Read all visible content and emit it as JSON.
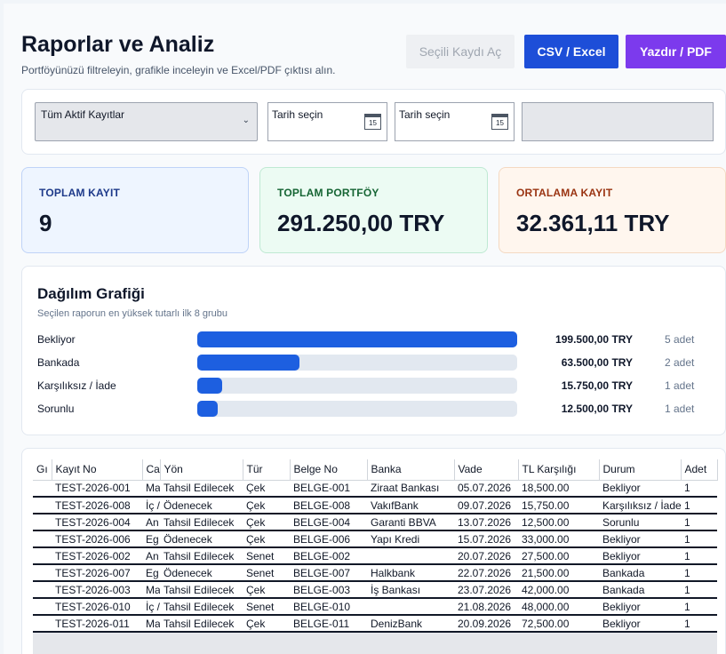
{
  "header": {
    "title": "Raporlar ve Analiz",
    "subtitle": "Portföyünüzü filtreleyin, grafikle inceleyin ve Excel/PDF çıktısı alın.",
    "buttons": {
      "open_selected": "Seçili Kaydı Aç",
      "csv": "CSV / Excel",
      "print": "Yazdır / PDF"
    }
  },
  "filters": {
    "report_select": "Tüm Aktif Kayıtlar",
    "date_start_placeholder": "Tarih seçin",
    "date_end_placeholder": "Tarih seçin",
    "calendar_glyph": "15"
  },
  "stats": [
    {
      "label": "TOPLAM KAYIT",
      "value": "9"
    },
    {
      "label": "TOPLAM PORTFÖY",
      "value": "291.250,00 TRY"
    },
    {
      "label": "ORTALAMA KAYIT",
      "value": "32.361,11 TRY"
    }
  ],
  "chart": {
    "title": "Dağılım Grafiği",
    "subtitle": "Seçilen raporun en yüksek tutarlı ilk 8 grubu"
  },
  "chart_data": {
    "type": "bar",
    "orientation": "horizontal",
    "categories": [
      "Bekliyor",
      "Bankada",
      "Karşılıksız / İade",
      "Sorunlu"
    ],
    "values": [
      199500,
      63500,
      15750,
      12500
    ],
    "amount_labels": [
      "199.500,00 TRY",
      "63.500,00 TRY",
      "15.750,00 TRY",
      "12.500,00 TRY"
    ],
    "counts": [
      "5 adet",
      "2 adet",
      "1 adet",
      "1 adet"
    ],
    "color": "#1d5fe0"
  },
  "table": {
    "columns": [
      "Gı",
      "Kayıt No",
      "Ca",
      "Yön",
      "Tür",
      "Belge No",
      "Banka",
      "Vade",
      "TL Karşılığı",
      "Durum",
      "Adet"
    ],
    "rows": [
      [
        "",
        "TEST-2026-001",
        "Ma",
        "Tahsil Edilecek",
        "Çek",
        "BELGE-001",
        "Ziraat Bankası",
        "05.07.2026",
        "18,500.00",
        "Bekliyor",
        "1"
      ],
      [
        "",
        "TEST-2026-008",
        "İç /",
        "Ödenecek",
        "Çek",
        "BELGE-008",
        "VakıfBank",
        "09.07.2026",
        "15,750.00",
        "Karşılıksız / İade",
        "1"
      ],
      [
        "",
        "TEST-2026-004",
        "An",
        "Tahsil Edilecek",
        "Çek",
        "BELGE-004",
        "Garanti BBVA",
        "13.07.2026",
        "12,500.00",
        "Sorunlu",
        "1"
      ],
      [
        "",
        "TEST-2026-006",
        "Eg",
        "Ödenecek",
        "Çek",
        "BELGE-006",
        "Yapı Kredi",
        "15.07.2026",
        "33,000.00",
        "Bekliyor",
        "1"
      ],
      [
        "",
        "TEST-2026-002",
        "An",
        "Tahsil Edilecek",
        "Senet",
        "BELGE-002",
        "",
        "20.07.2026",
        "27,500.00",
        "Bekliyor",
        "1"
      ],
      [
        "",
        "TEST-2026-007",
        "Eg",
        "Ödenecek",
        "Senet",
        "BELGE-007",
        "Halkbank",
        "22.07.2026",
        "21,500.00",
        "Bankada",
        "1"
      ],
      [
        "",
        "TEST-2026-003",
        "Ma",
        "Tahsil Edilecek",
        "Çek",
        "BELGE-003",
        "İş Bankası",
        "23.07.2026",
        "42,000.00",
        "Bankada",
        "1"
      ],
      [
        "",
        "TEST-2026-010",
        "İç /",
        "Tahsil Edilecek",
        "Senet",
        "BELGE-010",
        "",
        "21.08.2026",
        "48,000.00",
        "Bekliyor",
        "1"
      ],
      [
        "",
        "TEST-2026-011",
        "Ma",
        "Tahsil Edilecek",
        "Çek",
        "BELGE-011",
        "DenizBank",
        "20.09.2026",
        "72,500.00",
        "Bekliyor",
        "1"
      ]
    ]
  },
  "colors": {
    "accent_blue": "#1d4ed8",
    "accent_purple": "#7c3aed",
    "bar_blue": "#1d5fe0"
  }
}
